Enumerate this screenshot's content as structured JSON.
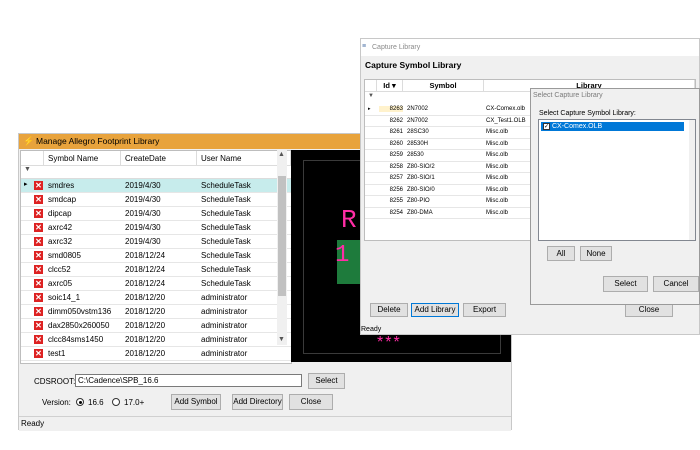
{
  "footprint": {
    "title": "Manage Allegro Footprint Library",
    "columns": [
      "Symbol Name",
      "CreateDate",
      "User Name"
    ],
    "rows": [
      {
        "name": "smdres",
        "date": "2019/4/30",
        "user": "ScheduleTask",
        "selected": true
      },
      {
        "name": "smdcap",
        "date": "2019/4/30",
        "user": "ScheduleTask"
      },
      {
        "name": "dipcap",
        "date": "2019/4/30",
        "user": "ScheduleTask"
      },
      {
        "name": "axrc42",
        "date": "2019/4/30",
        "user": "ScheduleTask"
      },
      {
        "name": "axrc32",
        "date": "2019/4/30",
        "user": "ScheduleTask"
      },
      {
        "name": "smd0805",
        "date": "2018/12/24",
        "user": "ScheduleTask"
      },
      {
        "name": "clcc52",
        "date": "2018/12/24",
        "user": "ScheduleTask"
      },
      {
        "name": "axrc05",
        "date": "2018/12/24",
        "user": "ScheduleTask"
      },
      {
        "name": "soic14_1",
        "date": "2018/12/20",
        "user": "administrator"
      },
      {
        "name": "dimm050vstm136",
        "date": "2018/12/20",
        "user": "administrator"
      },
      {
        "name": "dax2850x260050",
        "date": "2018/12/20",
        "user": "administrator"
      },
      {
        "name": "clcc84sms1450",
        "date": "2018/12/20",
        "user": "administrator"
      },
      {
        "name": "test1",
        "date": "2018/12/20",
        "user": "administrator"
      }
    ],
    "cdsroot_label": "CDSROOT:",
    "cdsroot_value": "C:\\Cadence\\SPB_16.6",
    "select_label": "Select",
    "version_label": "Version:",
    "version_options": [
      "16.6",
      "17.0+"
    ],
    "add_symbol_label": "Add Symbol",
    "add_directory_label": "Add Directory",
    "close_label": "Close",
    "status": "Ready",
    "preview": {
      "ref_text": "R",
      "pin_text": "1",
      "asterisks": "***"
    }
  },
  "capture": {
    "title": "Capture Library",
    "heading": "Capture Symbol Library",
    "columns": [
      "Id",
      "Symbol",
      "Library"
    ],
    "rows": [
      {
        "id": "8263",
        "symbol": "2N7002",
        "library": "CX-Comex.olb"
      },
      {
        "id": "8262",
        "symbol": "2N7002",
        "library": "CX_Test1.OLB"
      },
      {
        "id": "8261",
        "symbol": "28SC30",
        "library": "Misc.olb"
      },
      {
        "id": "8260",
        "symbol": "28530H",
        "library": "Misc.olb"
      },
      {
        "id": "8259",
        "symbol": "28530",
        "library": "Misc.olb"
      },
      {
        "id": "8258",
        "symbol": "Z80-SIO/2",
        "library": "Misc.olb"
      },
      {
        "id": "8257",
        "symbol": "Z80-SIO/1",
        "library": "Misc.olb"
      },
      {
        "id": "8256",
        "symbol": "Z80-SIO/0",
        "library": "Misc.olb"
      },
      {
        "id": "8255",
        "symbol": "Z80-PIO",
        "library": "Misc.olb"
      },
      {
        "id": "8254",
        "symbol": "Z80-DMA",
        "library": "Misc.olb"
      }
    ],
    "delete_label": "Delete",
    "add_library_label": "Add Library",
    "export_label": "Export",
    "close_label": "Close",
    "status": "Ready"
  },
  "select_dialog": {
    "title": "Select Capture Library",
    "label": "Select Capture Symbol Library:",
    "items": [
      "CX-Comex.OLB"
    ],
    "all_label": "All",
    "none_label": "None",
    "select_label": "Select",
    "cancel_label": "Cancel"
  }
}
